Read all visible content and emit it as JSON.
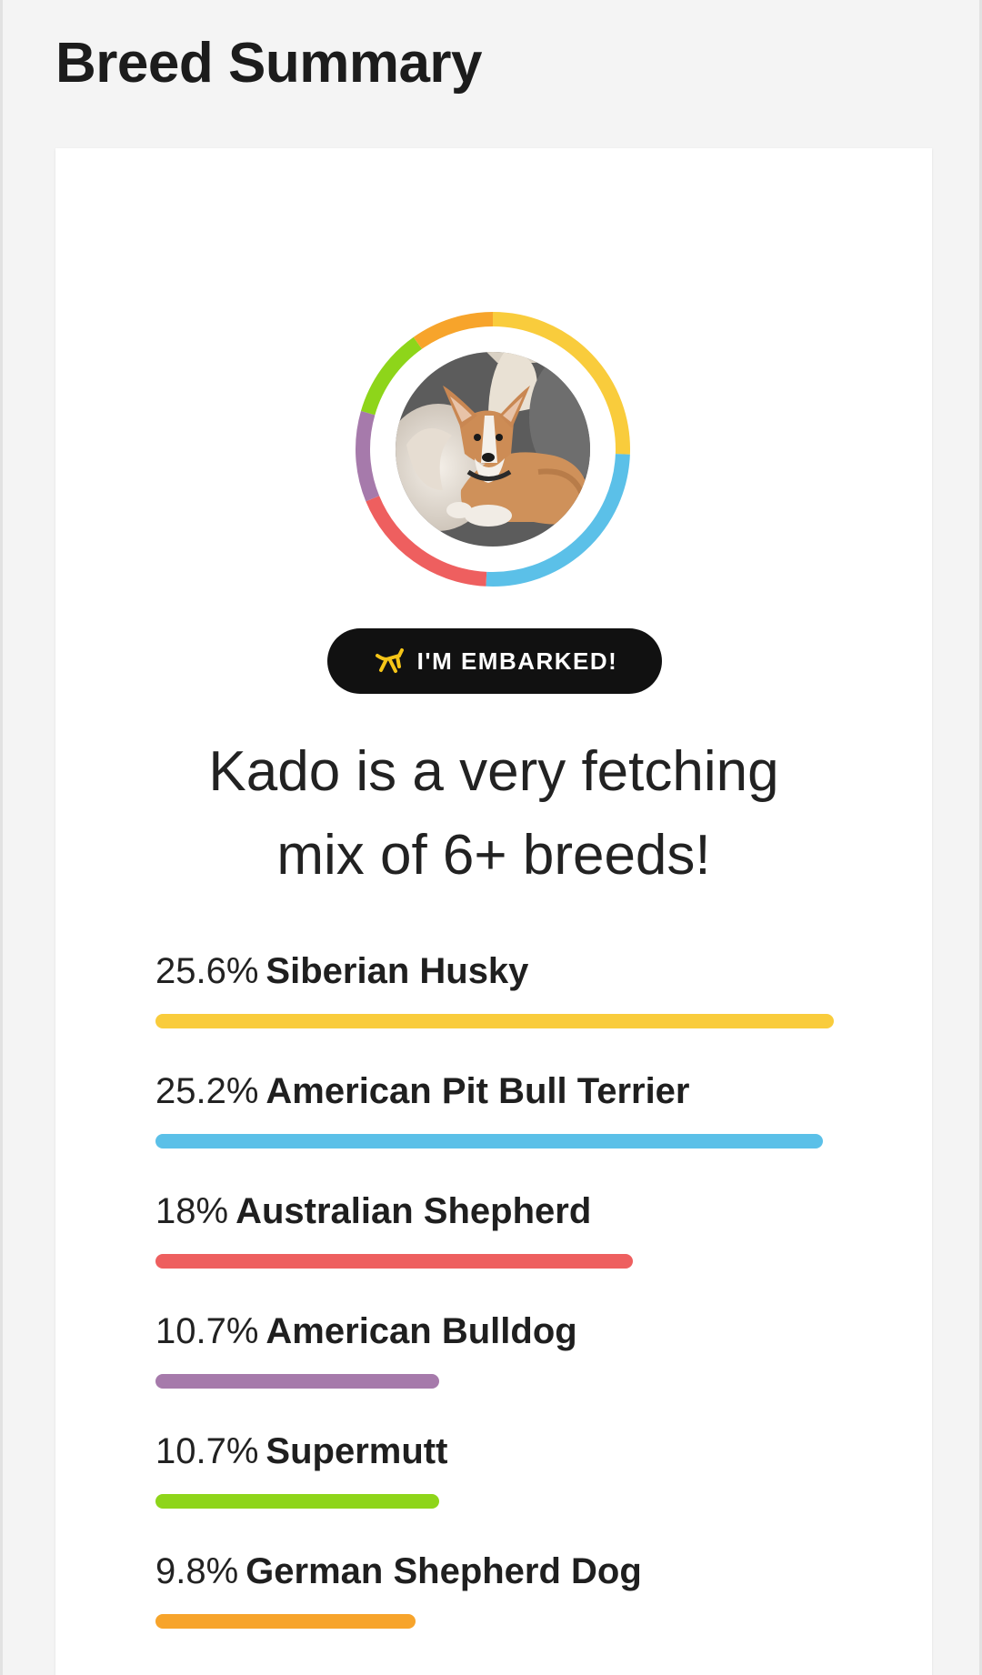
{
  "header": {
    "title": "Breed Summary"
  },
  "badge": {
    "label": "I'M EMBARKED!",
    "icon": "balloon-dog-icon",
    "icon_color": "#f5c518"
  },
  "headline": {
    "line1": "Kado is a very fetching",
    "line2": "mix of 6+ breeds!"
  },
  "profile": {
    "photo": "dog-photo"
  },
  "breeds": [
    {
      "pct": "25.6%",
      "name": "Siberian Husky",
      "value": 25.6,
      "color": "#f9cc3c"
    },
    {
      "pct": "25.2%",
      "name": "American Pit Bull Terrier",
      "value": 25.2,
      "color": "#5bc0e8"
    },
    {
      "pct": "18%",
      "name": "Australian Shepherd",
      "value": 18,
      "color": "#ee5f5f"
    },
    {
      "pct": "10.7%",
      "name": "American Bulldog",
      "value": 10.7,
      "color": "#a67aab"
    },
    {
      "pct": "10.7%",
      "name": "Supermutt",
      "value": 10.7,
      "color": "#8ed51a"
    },
    {
      "pct": "9.8%",
      "name": "German Shepherd Dog",
      "value": 9.8,
      "color": "#f7a42b"
    }
  ]
}
